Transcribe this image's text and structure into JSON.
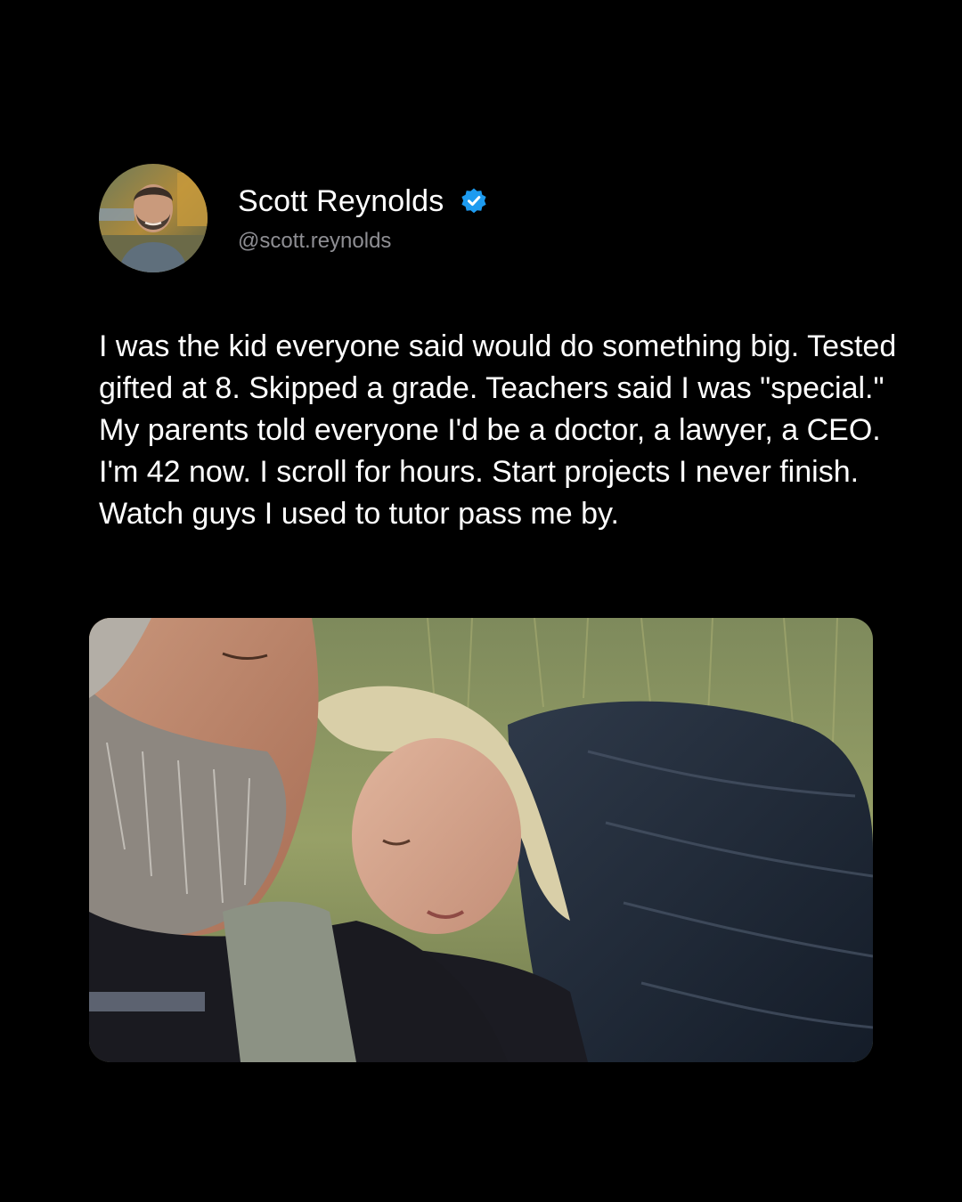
{
  "post": {
    "author": {
      "name": "Scott Reynolds",
      "handle": "@scott.reynolds",
      "verified": true,
      "avatar_icon": "profile-photo-avatar",
      "verified_icon": "verified-badge-icon"
    },
    "text": "I was the kid everyone said would do something big. Tested gifted at 8. Skipped a grade. Teachers said I was \"special.\" My parents told everyone I'd be a doctor, a lawyer, a CEO. I'm 42 now. I scroll for hours. Start projects I never finish. Watch guys I used to tutor pass me by.",
    "media": {
      "type": "photo"
    }
  },
  "colors": {
    "background": "#000000",
    "text_primary": "#ffffff",
    "text_secondary": "#8e8e93",
    "verified_badge": "#1d9bf0"
  }
}
